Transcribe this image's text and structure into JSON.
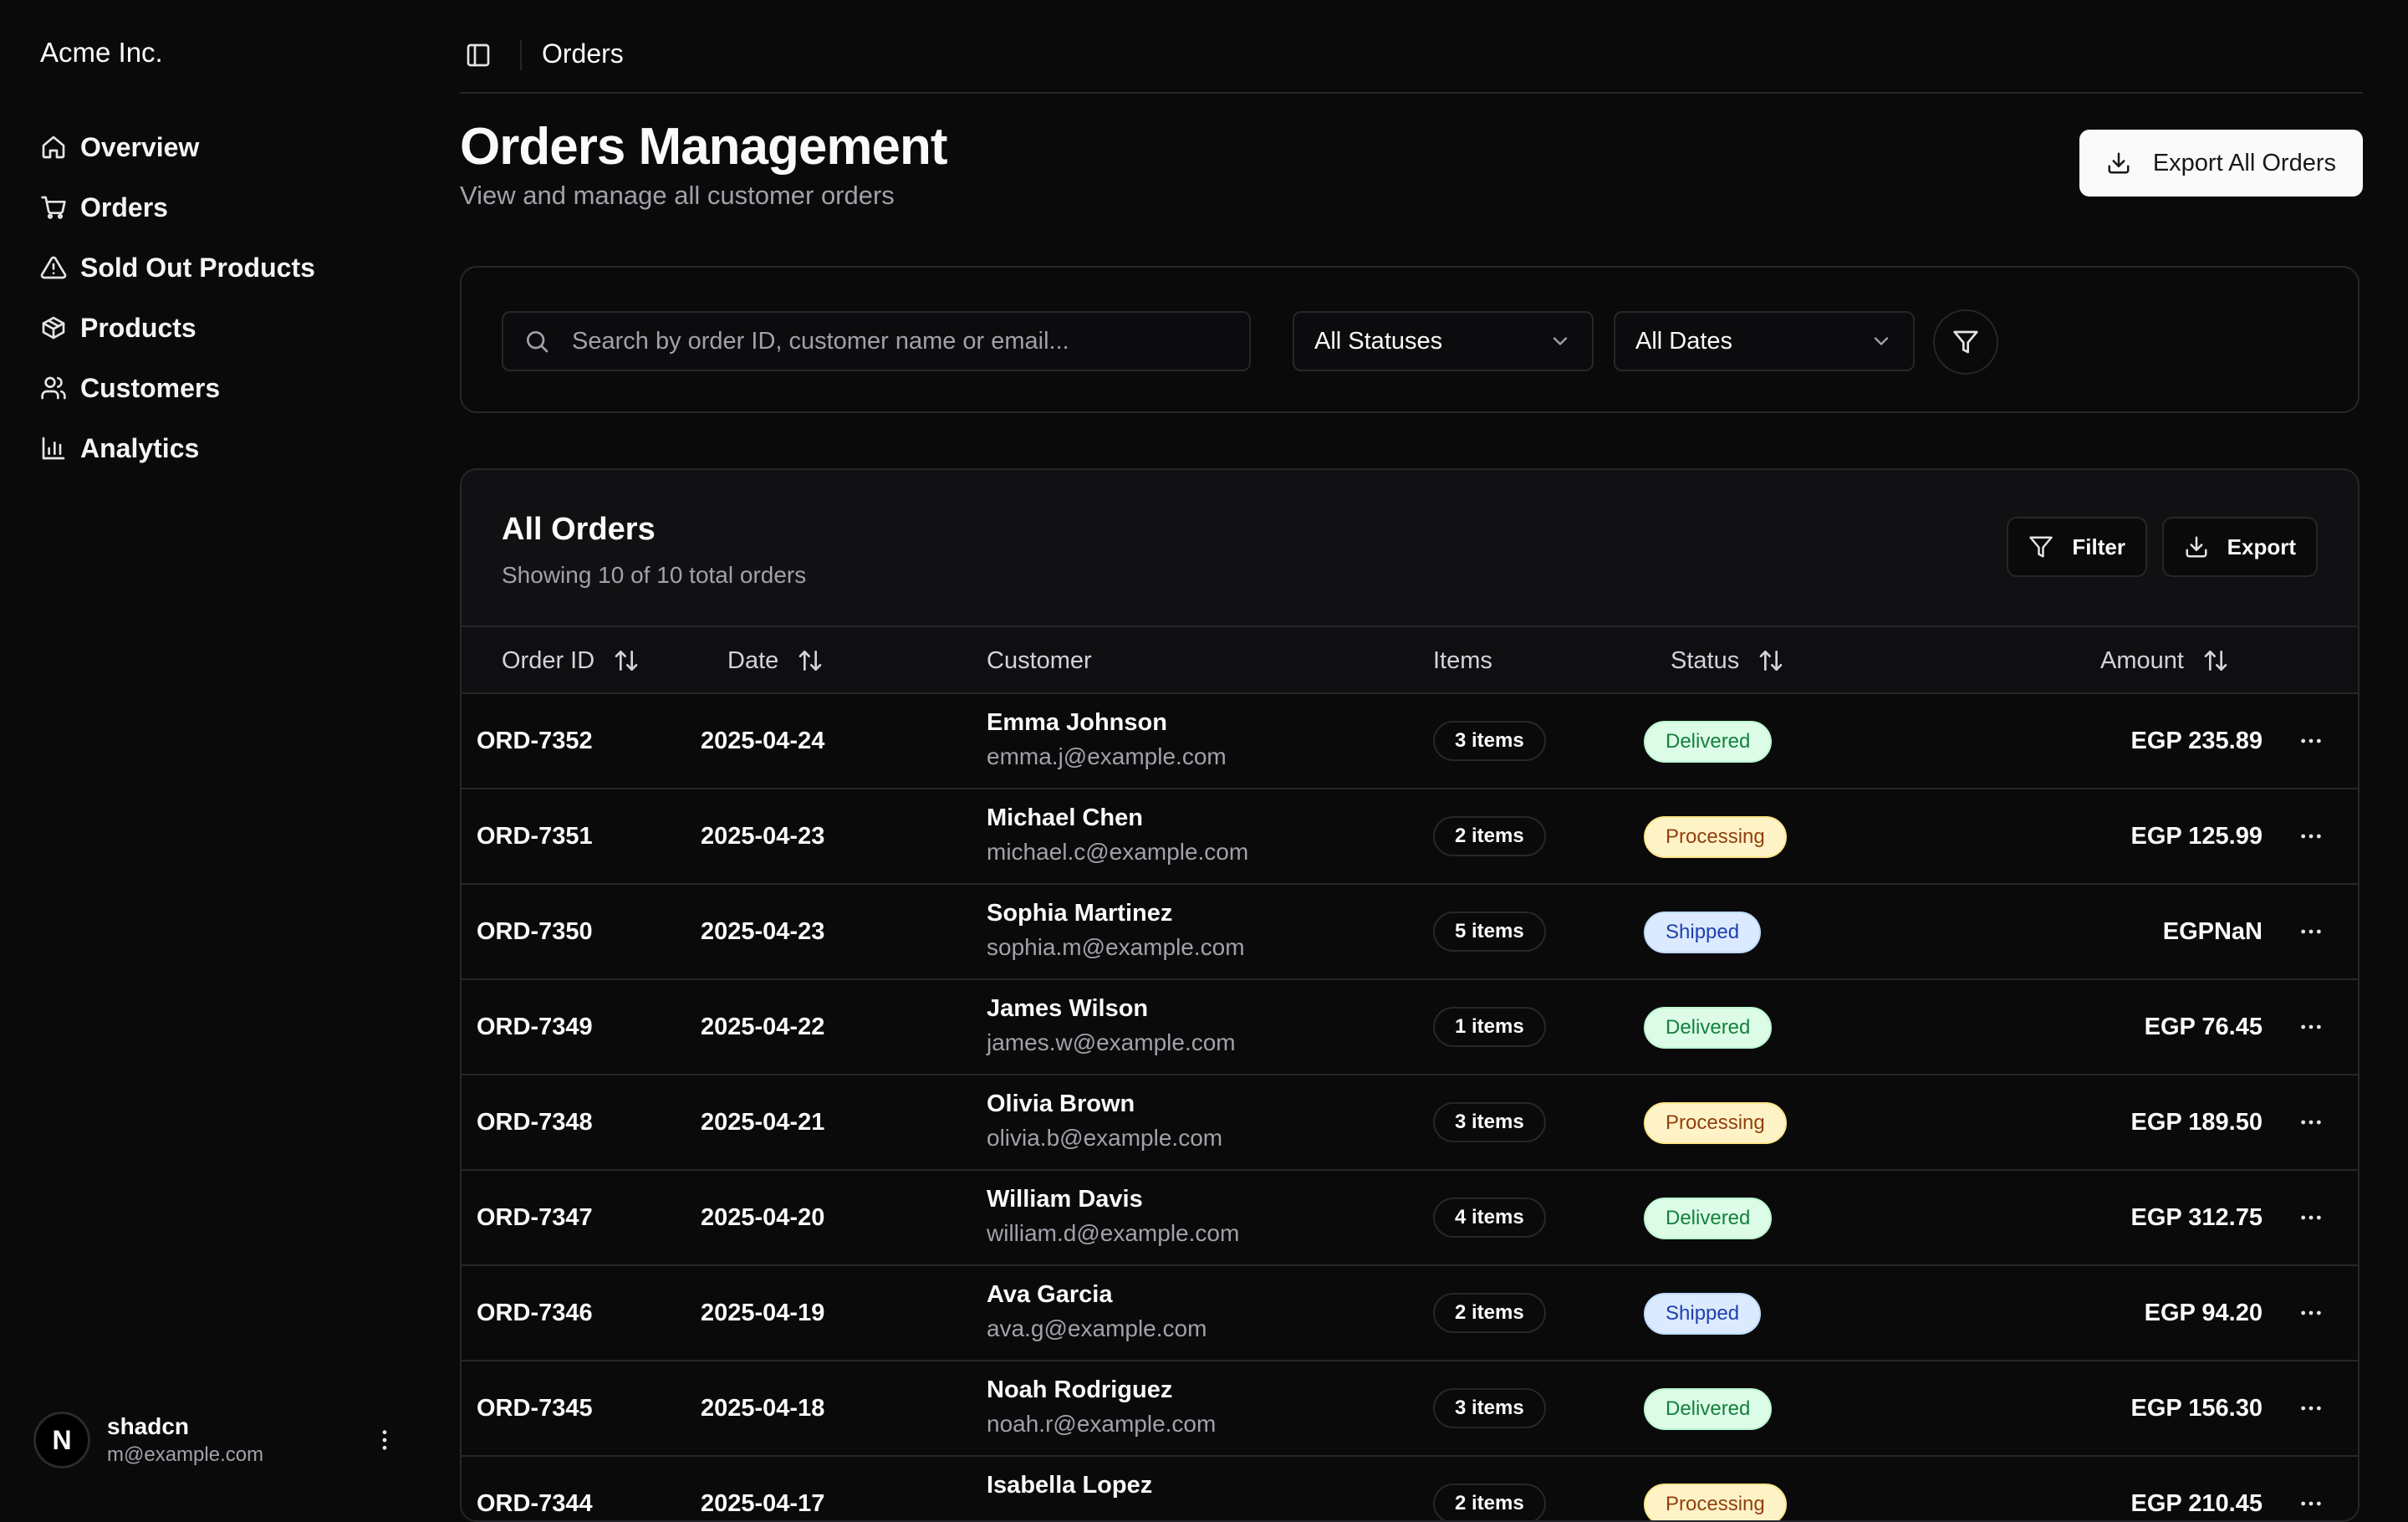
{
  "sidebar": {
    "brand": "Acme Inc.",
    "items": [
      {
        "label": "Overview",
        "icon": "home-icon"
      },
      {
        "label": "Orders",
        "icon": "cart-icon"
      },
      {
        "label": "Sold Out Products",
        "icon": "alert-triangle-icon"
      },
      {
        "label": "Products",
        "icon": "package-icon"
      },
      {
        "label": "Customers",
        "icon": "users-icon"
      },
      {
        "label": "Analytics",
        "icon": "bar-chart-icon"
      }
    ],
    "user": {
      "initial": "N",
      "name": "shadcn",
      "email": "m@example.com"
    }
  },
  "topbar": {
    "breadcrumb": "Orders"
  },
  "header": {
    "title": "Orders Management",
    "subtitle": "View and manage all customer orders",
    "export_all_label": "Export All Orders"
  },
  "filters": {
    "search_placeholder": "Search by order ID, customer name or email...",
    "status_value": "All Statuses",
    "date_value": "All Dates"
  },
  "orders": {
    "title": "All Orders",
    "subtitle": "Showing 10 of 10 total orders",
    "filter_label": "Filter",
    "export_label": "Export",
    "columns": {
      "order_id": "Order ID",
      "date": "Date",
      "customer": "Customer",
      "items": "Items",
      "status": "Status",
      "amount": "Amount"
    },
    "rows": [
      {
        "id": "ORD-7352",
        "date": "2025-04-24",
        "name": "Emma Johnson",
        "email": "emma.j@example.com",
        "items": "3 items",
        "status": "Delivered",
        "amount": "EGP 235.89"
      },
      {
        "id": "ORD-7351",
        "date": "2025-04-23",
        "name": "Michael Chen",
        "email": "michael.c@example.com",
        "items": "2 items",
        "status": "Processing",
        "amount": "EGP 125.99"
      },
      {
        "id": "ORD-7350",
        "date": "2025-04-23",
        "name": "Sophia Martinez",
        "email": "sophia.m@example.com",
        "items": "5 items",
        "status": "Shipped",
        "amount": "EGPNaN"
      },
      {
        "id": "ORD-7349",
        "date": "2025-04-22",
        "name": "James Wilson",
        "email": "james.w@example.com",
        "items": "1 items",
        "status": "Delivered",
        "amount": "EGP 76.45"
      },
      {
        "id": "ORD-7348",
        "date": "2025-04-21",
        "name": "Olivia Brown",
        "email": "olivia.b@example.com",
        "items": "3 items",
        "status": "Processing",
        "amount": "EGP 189.50"
      },
      {
        "id": "ORD-7347",
        "date": "2025-04-20",
        "name": "William Davis",
        "email": "william.d@example.com",
        "items": "4 items",
        "status": "Delivered",
        "amount": "EGP 312.75"
      },
      {
        "id": "ORD-7346",
        "date": "2025-04-19",
        "name": "Ava Garcia",
        "email": "ava.g@example.com",
        "items": "2 items",
        "status": "Shipped",
        "amount": "EGP 94.20"
      },
      {
        "id": "ORD-7345",
        "date": "2025-04-18",
        "name": "Noah Rodriguez",
        "email": "noah.r@example.com",
        "items": "3 items",
        "status": "Delivered",
        "amount": "EGP 156.30"
      },
      {
        "id": "ORD-7344",
        "date": "2025-04-17",
        "name": "Isabella Lopez",
        "email": "",
        "items": "2 items",
        "status": "Processing",
        "amount": "EGP 210.45"
      }
    ],
    "status_colors": {
      "Delivered": {
        "bg": "#dcfce7",
        "fg": "#15803d",
        "border": "#bbf7d0"
      },
      "Processing": {
        "bg": "#fef3c7",
        "fg": "#92400e",
        "border": "#fde68a"
      },
      "Shipped": {
        "bg": "#dbeafe",
        "fg": "#1e40af",
        "border": "#bfdbfe"
      }
    }
  }
}
